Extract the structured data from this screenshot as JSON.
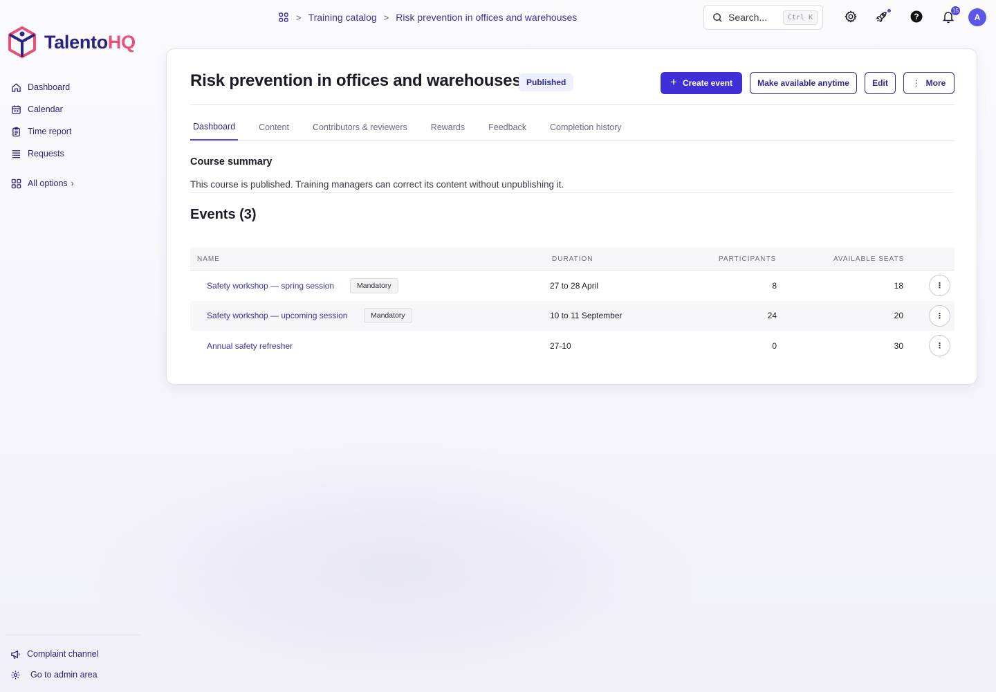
{
  "app": {
    "brand_main": "Talento",
    "brand_accent": "HQ"
  },
  "breadcrumb": {
    "items": [
      "Training catalog",
      "Risk prevention in offices and warehouses"
    ]
  },
  "search": {
    "placeholder": "Search...",
    "shortcut": "Ctrl K"
  },
  "notifications": {
    "count": "15"
  },
  "user": {
    "initial": "A"
  },
  "sidebar": {
    "items": [
      {
        "label": "Dashboard",
        "icon": "home-icon"
      },
      {
        "label": "Calendar",
        "icon": "calendar-icon"
      },
      {
        "label": "Time report",
        "icon": "clipboard-icon"
      },
      {
        "label": "Requests",
        "icon": "list-icon"
      }
    ],
    "all_options": "All options",
    "bottom": [
      {
        "label": "Complaint channel",
        "icon": "megaphone-icon"
      },
      {
        "label": "Go to admin area",
        "icon": "gear-icon"
      }
    ]
  },
  "course": {
    "title": "Risk prevention in offices and warehouses",
    "status": "Published",
    "actions": {
      "create": "Create event",
      "anytime": "Make available anytime",
      "edit": "Edit",
      "more": "More"
    },
    "tabs": [
      "Dashboard",
      "Content",
      "Contributors & reviewers",
      "Rewards",
      "Feedback",
      "Completion history"
    ],
    "summary_title": "Course summary",
    "summary_text": "This course is published. Training managers can correct its content without unpublishing it.",
    "events_title": "Events (3)"
  },
  "table": {
    "headers": {
      "name": "NAME",
      "duration": "DURATION",
      "participants": "PARTICIPANTS",
      "seats": "AVAILABLE SEATS"
    },
    "rows": [
      {
        "name": "Safety workshop — spring session",
        "tag": "Mandatory",
        "duration": "27 to 28 April",
        "participants": "8",
        "seats": "18"
      },
      {
        "name": "Safety workshop — upcoming session",
        "tag": "Mandatory",
        "duration": "10 to 11 September",
        "participants": "24",
        "seats": "20"
      },
      {
        "name": "Annual safety refresher",
        "tag": "",
        "duration": "27-10",
        "participants": "0",
        "seats": "30"
      }
    ]
  },
  "colors": {
    "primary": "#3f2fd6",
    "brand_navy": "#2a2380",
    "brand_pink": "#e8517a",
    "link": "#3b34a0"
  }
}
